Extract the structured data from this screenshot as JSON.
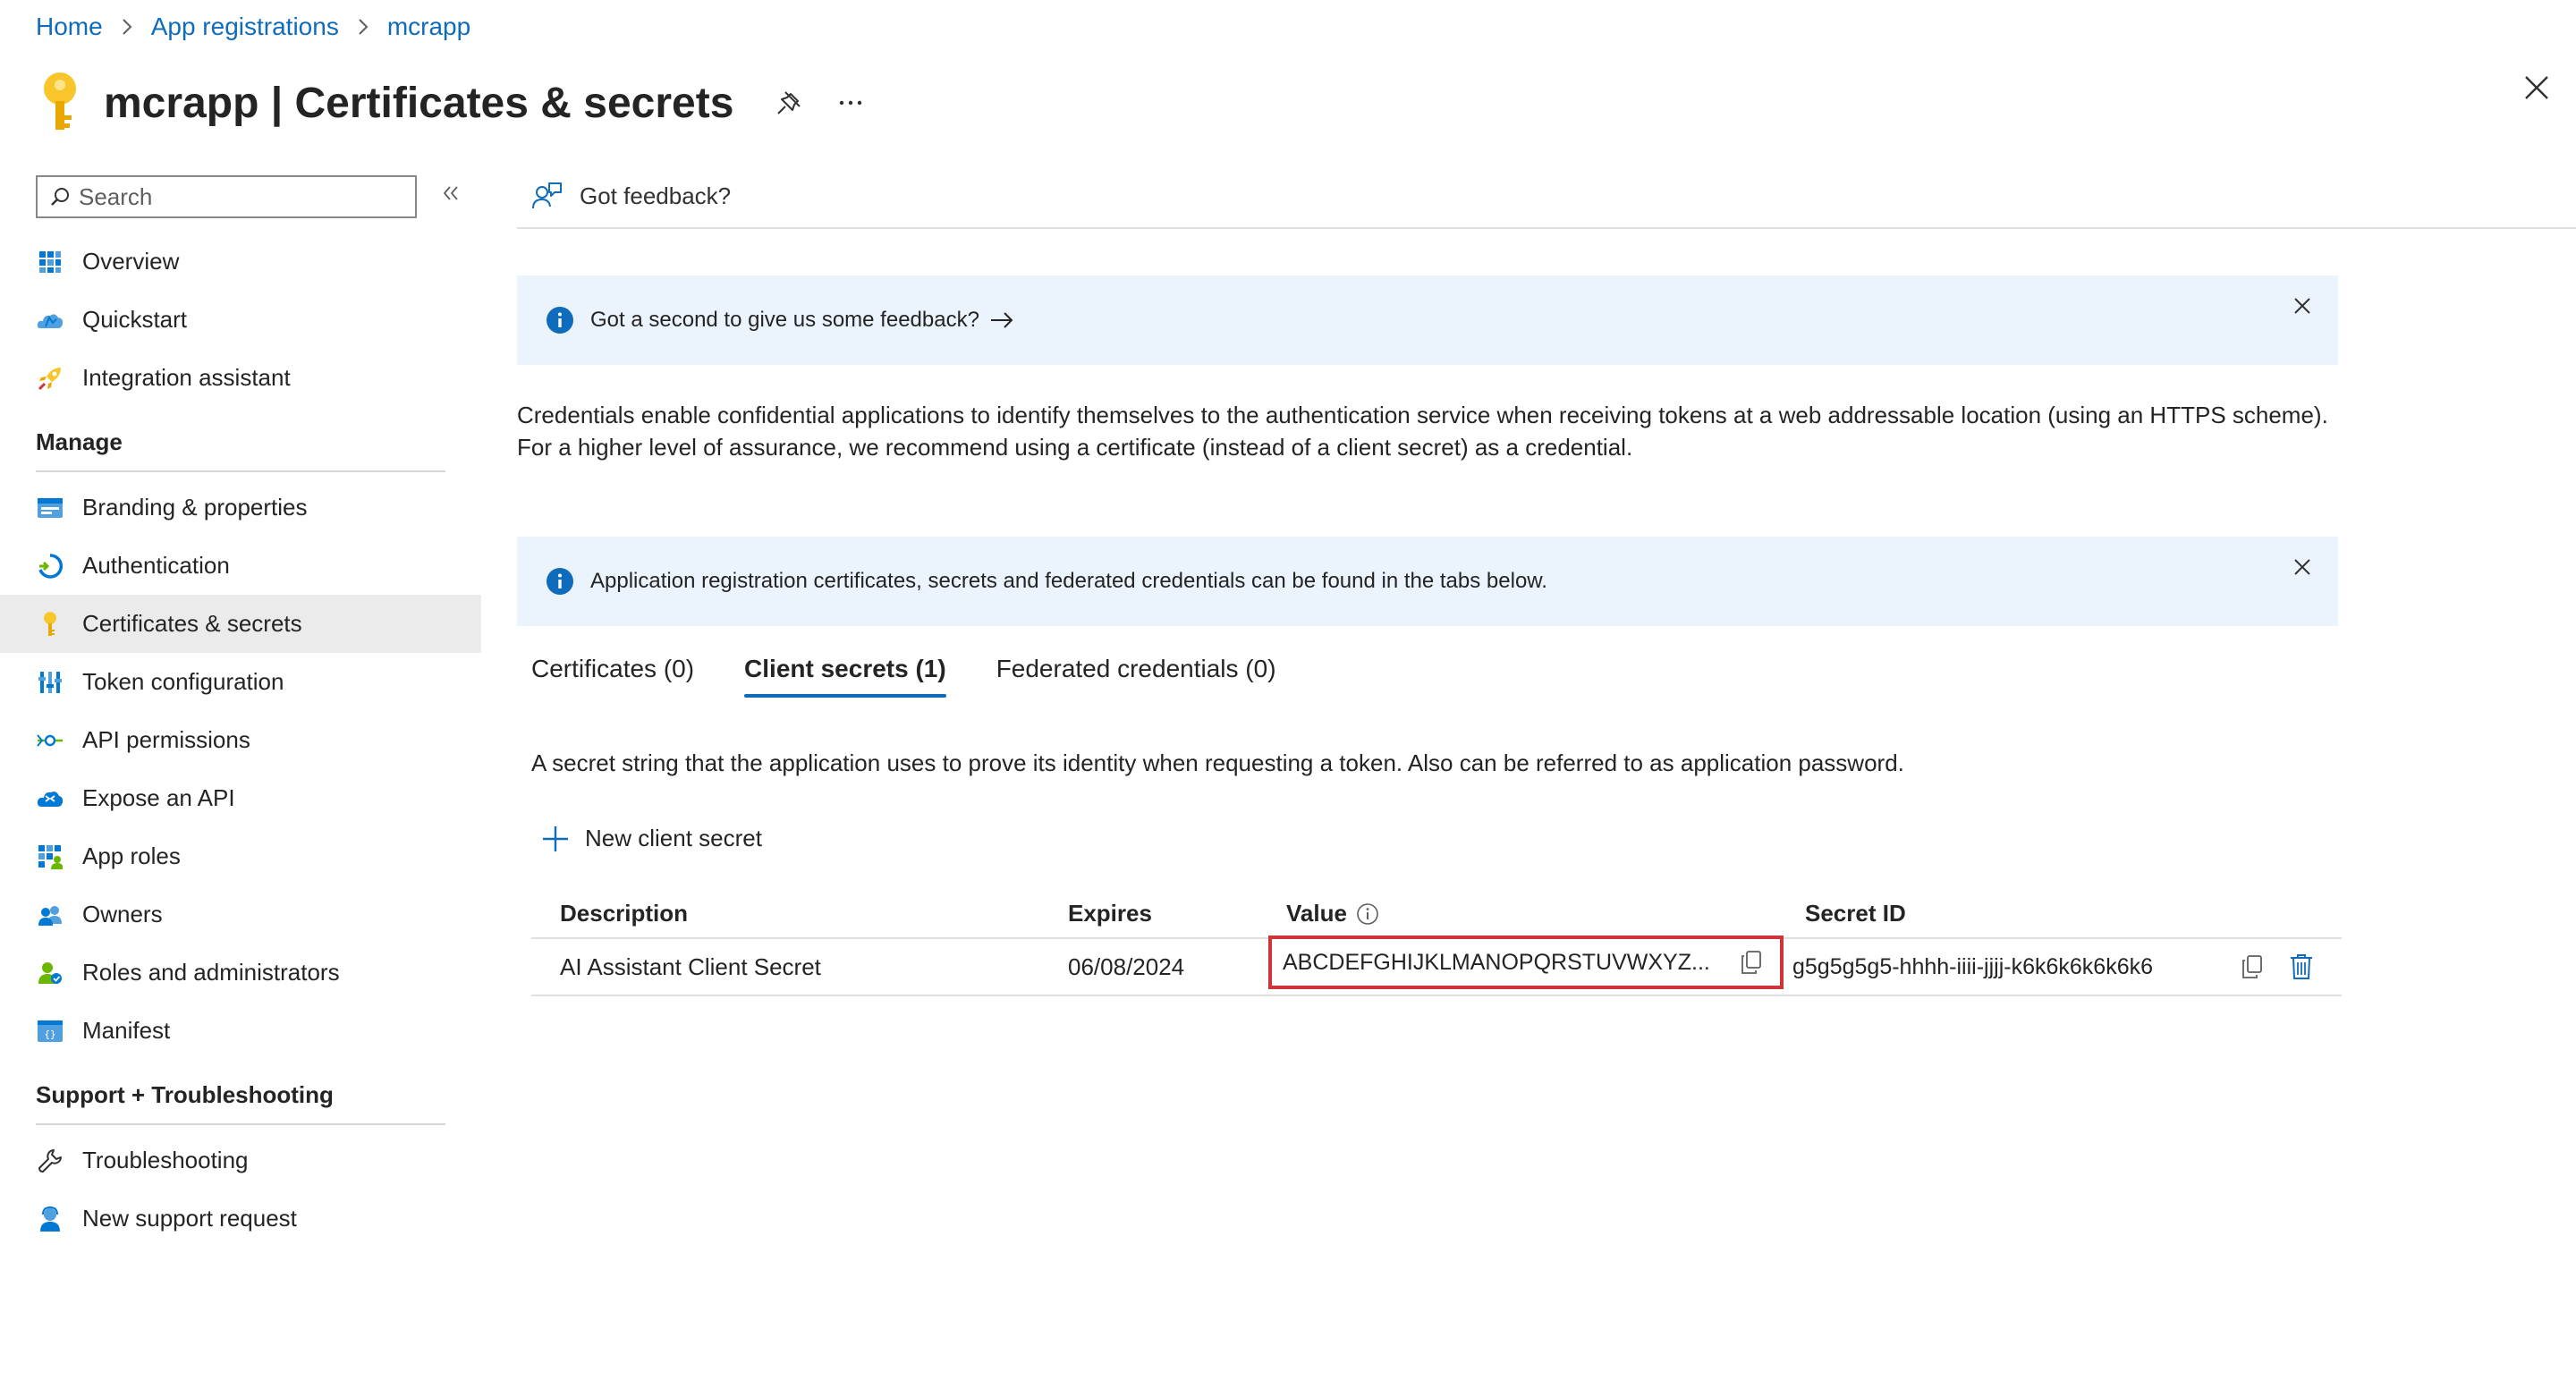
{
  "breadcrumb": {
    "items": [
      "Home",
      "App registrations",
      "mcrapp"
    ]
  },
  "header": {
    "app_name": "mcrapp",
    "title_sep": " | ",
    "page_name": "Certificates & secrets"
  },
  "sidebar": {
    "search_placeholder": "Search",
    "top_items": [
      {
        "label": "Overview",
        "icon": "overview-icon"
      },
      {
        "label": "Quickstart",
        "icon": "quickstart-icon"
      },
      {
        "label": "Integration assistant",
        "icon": "rocket-icon"
      }
    ],
    "manage_title": "Manage",
    "manage_items": [
      {
        "label": "Branding & properties",
        "icon": "branding-icon"
      },
      {
        "label": "Authentication",
        "icon": "authentication-icon"
      },
      {
        "label": "Certificates & secrets",
        "icon": "key-icon",
        "active": true
      },
      {
        "label": "Token configuration",
        "icon": "token-icon"
      },
      {
        "label": "API permissions",
        "icon": "api-permissions-icon"
      },
      {
        "label": "Expose an API",
        "icon": "cloud-icon"
      },
      {
        "label": "App roles",
        "icon": "app-roles-icon"
      },
      {
        "label": "Owners",
        "icon": "owners-icon"
      },
      {
        "label": "Roles and administrators",
        "icon": "roles-icon"
      },
      {
        "label": "Manifest",
        "icon": "manifest-icon"
      }
    ],
    "support_title": "Support + Troubleshooting",
    "support_items": [
      {
        "label": "Troubleshooting",
        "icon": "wrench-icon"
      },
      {
        "label": "New support request",
        "icon": "support-icon"
      }
    ]
  },
  "main": {
    "feedback_label": "Got feedback?",
    "banner1_text": "Got a second to give us some feedback?",
    "description": "Credentials enable confidential applications to identify themselves to the authentication service when receiving tokens at a web addressable location (using an HTTPS scheme). For a higher level of assurance, we recommend using a certificate (instead of a client secret) as a credential.",
    "banner2_text": "Application registration certificates, secrets and federated credentials can be found in the tabs below.",
    "tabs": [
      {
        "label": "Certificates (0)",
        "active": false
      },
      {
        "label": "Client secrets (1)",
        "active": true
      },
      {
        "label": "Federated credentials (0)",
        "active": false
      }
    ],
    "tab_description": "A secret string that the application uses to prove its identity when requesting a token. Also can be referred to as application password.",
    "new_secret_label": "New client secret",
    "table": {
      "headers": {
        "description": "Description",
        "expires": "Expires",
        "value": "Value",
        "secret_id": "Secret ID"
      },
      "rows": [
        {
          "description": "AI Assistant Client Secret",
          "expires": "06/08/2024",
          "value": "ABCDEFGHIJKLMANOPQRSTUVWXYZ...",
          "secret_id": "g5g5g5g5-hhhh-iiii-jjjj-k6k6k6k6k6k6"
        }
      ]
    }
  },
  "colors": {
    "link": "#0f6cbd",
    "banner_bg": "#ebf3fc",
    "highlight_border": "#d13438",
    "active_nav_bg": "#ebebeb"
  }
}
